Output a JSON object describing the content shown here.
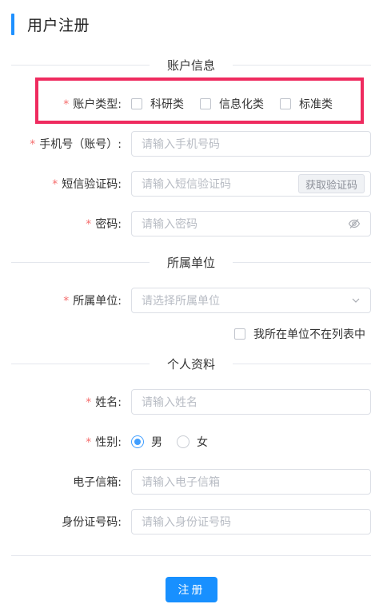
{
  "page_title": "用户注册",
  "sections": {
    "account": "账户信息",
    "unit": "所属单位",
    "personal": "个人资料"
  },
  "required_mark": "*",
  "account_type": {
    "label": "账户类型:",
    "options": [
      "科研类",
      "信息化类",
      "标准类"
    ]
  },
  "phone": {
    "label": "手机号（账号）:",
    "placeholder": "请输入手机号码"
  },
  "sms_code": {
    "label": "短信验证码:",
    "placeholder": "请输入短信验证码",
    "button": "获取验证码"
  },
  "password": {
    "label": "密码:",
    "placeholder": "请输入密码",
    "icon": "eye-hidden-icon"
  },
  "unit": {
    "label": "所属单位:",
    "placeholder": "请选择所属单位",
    "icon": "chevron-down-icon"
  },
  "not_in_list": "我所在单位不在列表中",
  "name": {
    "label": "姓名:",
    "placeholder": "请输入姓名"
  },
  "gender": {
    "label": "性别:",
    "options": [
      "男",
      "女"
    ],
    "selected": "男"
  },
  "email": {
    "label": "电子信箱:",
    "placeholder": "请输入电子信箱"
  },
  "id_number": {
    "label": "身份证号码:",
    "placeholder": "请输入身份证号码"
  },
  "submit_label": "注册",
  "colors": {
    "accent": "#1890ff",
    "required": "#f56c6c",
    "highlight": "#ef2b5f"
  }
}
